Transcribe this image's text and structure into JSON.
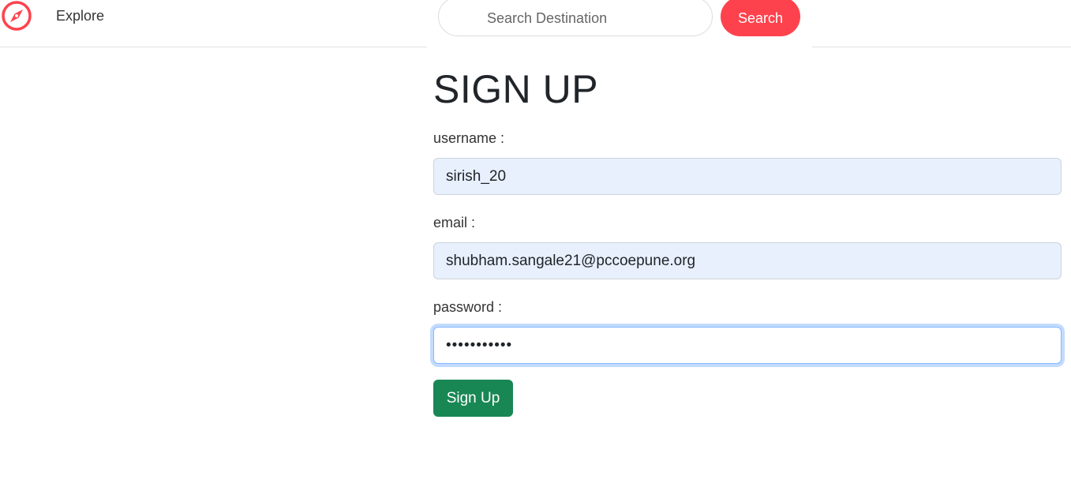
{
  "nav": {
    "brand_icon": "compass-icon",
    "explore_label": "Explore",
    "search_placeholder": "Search Destination",
    "search_button": "Search"
  },
  "colors": {
    "brand": "#fe424d",
    "success": "#198754",
    "autofill_bg": "#e8f0fe",
    "focus_border": "#86b7fe"
  },
  "form": {
    "title": "SIGN UP",
    "username_label": "username :",
    "username_value": "sirish_20",
    "email_label": "email :",
    "email_value": "shubham.sangale21@pccoepune.org",
    "password_label": "password :",
    "password_value": "•••••••••••",
    "submit_label": "Sign Up"
  }
}
